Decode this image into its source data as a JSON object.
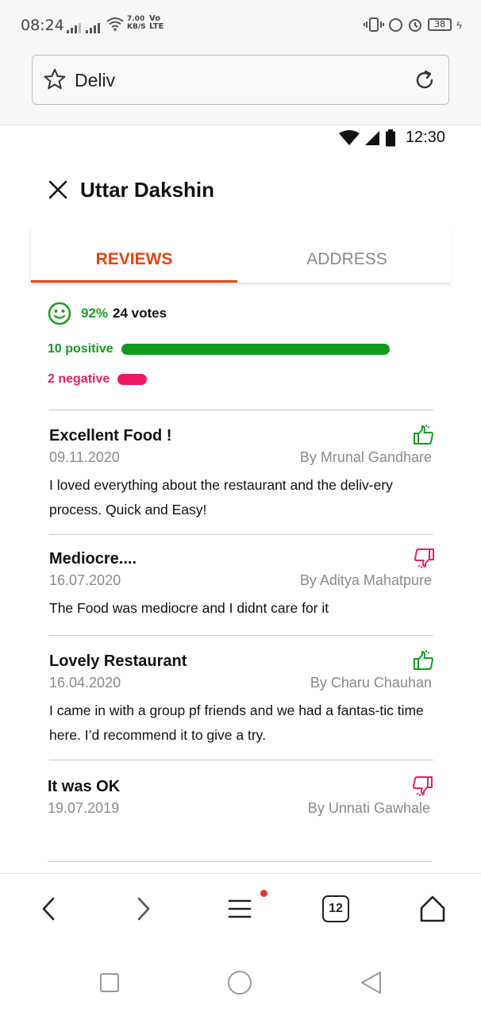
{
  "status_bar": {
    "time": "08:24",
    "net_speed_value": "7.00",
    "net_speed_unit": "KB/S",
    "volte_top": "Vo",
    "volte_bottom": "LTE",
    "battery": "38"
  },
  "browser": {
    "url_text": "Deliv",
    "tab_count": "12"
  },
  "app_status": {
    "time": "12:30"
  },
  "page": {
    "title": "Uttar Dakshin"
  },
  "tabs": [
    {
      "label": "REVIEWS",
      "active": true
    },
    {
      "label": "ADDRESS",
      "active": false
    }
  ],
  "summary": {
    "percent": "92%",
    "votes": "24 votes",
    "positive": {
      "label": "10 positive",
      "fraction": 1.0
    },
    "negative": {
      "label": "2 negative",
      "fraction": 0.11
    }
  },
  "reviews": [
    {
      "title": "Excellent Food !",
      "date": "09.11.2020",
      "author": "By Mrunal Gandhare",
      "body": "I loved everything about the restaurant and the deliv-ery process. Quick and Easy!",
      "sentiment": "thumbs-up"
    },
    {
      "title": "Mediocre....",
      "date": "16.07.2020",
      "author": "By Aditya Mahatpure",
      "body": "The Food was mediocre and I didnt care for it",
      "sentiment": "thumbs-down"
    },
    {
      "title": "Lovely Restaurant",
      "date": "16.04.2020",
      "author": "By Charu Chauhan",
      "body": "I came in with a group pf friends and we had a fantas-tic time here. I’d recommend it to give a try.",
      "sentiment": "thumbs-up"
    },
    {
      "title": "It was OK",
      "date": "19.07.2019",
      "author": "By Unnati Gawhale",
      "body": "",
      "sentiment": "thumbs-down"
    }
  ],
  "colors": {
    "accent": "#e8420f",
    "positive": "#109a1c",
    "negative": "#f01663"
  }
}
